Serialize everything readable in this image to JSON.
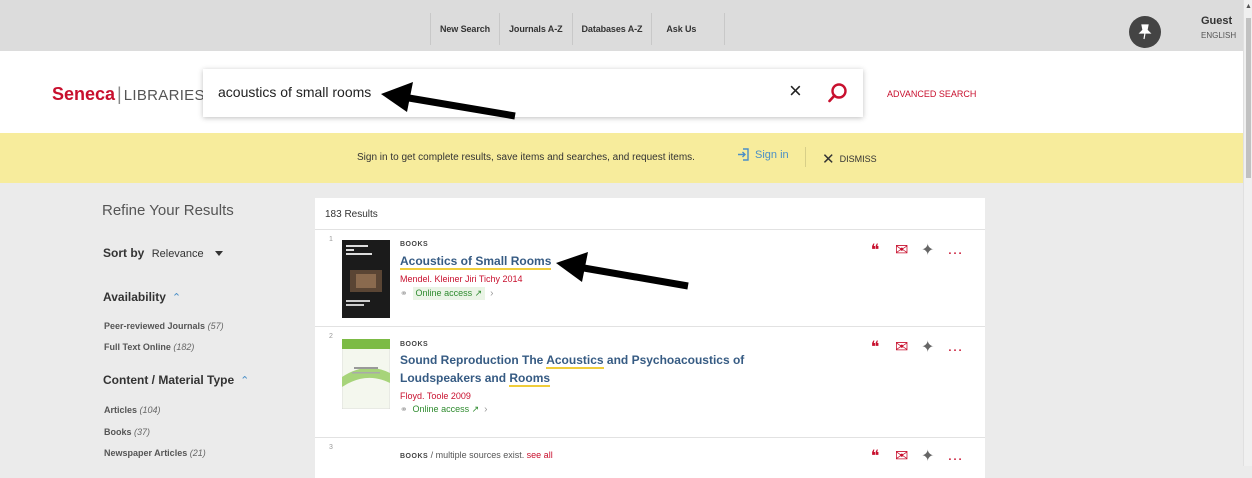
{
  "topnav": [
    "New Search",
    "Journals A-Z",
    "Databases A-Z",
    "Ask Us"
  ],
  "user": {
    "name": "Guest",
    "language": "ENGLISH"
  },
  "logo": {
    "brand": "Seneca",
    "divider": "|",
    "suffix": "LIBRARIES"
  },
  "search": {
    "query": "acoustics of small rooms",
    "clear": "×"
  },
  "advanced_search": "ADVANCED SEARCH",
  "banner": {
    "message": "Sign in to get complete results, save items and searches, and request items.",
    "signin": "Sign in",
    "dismiss": "DISMISS"
  },
  "sidebar": {
    "title": "Refine Your Results",
    "sort_label": "Sort by",
    "sort_value": "Relevance",
    "availability": {
      "heading": "Availability",
      "items": [
        {
          "label": "Peer-reviewed Journals",
          "count": "(57)"
        },
        {
          "label": "Full Text Online",
          "count": "(182)"
        }
      ]
    },
    "content_type": {
      "heading": "Content / Material Type",
      "items": [
        {
          "label": "Articles",
          "count": "(104)"
        },
        {
          "label": "Books",
          "count": "(37)"
        },
        {
          "label": "Newspaper Articles",
          "count": "(21)"
        }
      ]
    }
  },
  "results": {
    "count_label": "183 Results",
    "items": [
      {
        "index": "1",
        "type": "BOOKS",
        "title": "Acoustics of Small Rooms",
        "author": "Mendel. Kleiner Jiri Tichy 2014",
        "access": "Online access"
      },
      {
        "index": "2",
        "type": "BOOKS",
        "title_parts": [
          "Sound Reproduction The ",
          "Acoustics",
          " and Psychoacoustics of",
          "Loudspeakers and ",
          "Rooms"
        ],
        "author": "Floyd. Toole 2009",
        "access": "Online access"
      },
      {
        "index": "3",
        "type": "BOOKS",
        "source_note": " / multiple sources exist.",
        "see_all": "see all"
      }
    ]
  },
  "colors": {
    "brand_red": "#c8102e",
    "link_blue": "#365b83",
    "banner_yellow": "#f7ec9c",
    "highlight": "#f0cd3a"
  }
}
